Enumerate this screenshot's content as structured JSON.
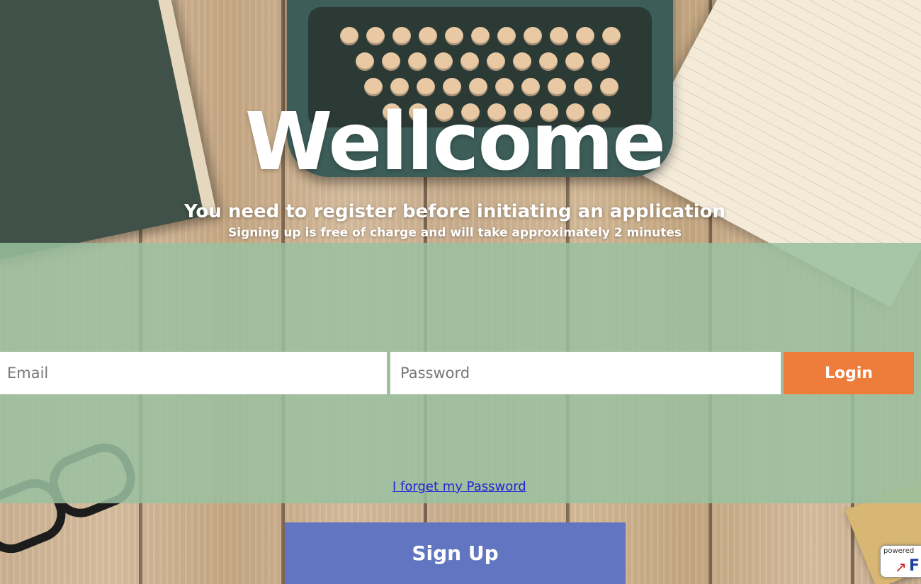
{
  "header": {
    "title": "Wellcome",
    "subtitle": "You need to register before initiating an application",
    "note": "Signing up is free of charge and will take approximately 2 minutes"
  },
  "login_form": {
    "email_placeholder": "Email",
    "email_value": "",
    "password_placeholder": "Password",
    "password_value": "",
    "login_label": "Login",
    "forgot_label": "I forget my Password"
  },
  "signup": {
    "label": "Sign Up"
  },
  "badge": {
    "text": "powered",
    "letter": "F",
    "icon": "arrow-icon"
  },
  "colors": {
    "login_button": "#ee7d3b",
    "signup_button": "#6175c0",
    "overlay_band": "#9ac0a0",
    "link": "#2323d6"
  }
}
